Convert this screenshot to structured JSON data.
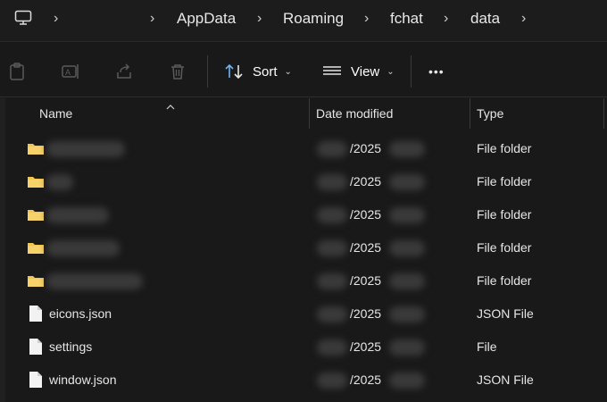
{
  "address_bar": {
    "icon": "monitor-icon",
    "segments": [
      "AppData",
      "Roaming",
      "fchat",
      "data"
    ]
  },
  "toolbar": {
    "sort_label": "Sort",
    "view_label": "View",
    "more_label": "•••"
  },
  "columns": {
    "name": "Name",
    "date_modified": "Date modified",
    "type": "Type"
  },
  "rows": [
    {
      "name": "",
      "date": "/2025",
      "type": "File folder",
      "icon": "folder-icon"
    },
    {
      "name": "",
      "date": "/2025",
      "type": "File folder",
      "icon": "folder-icon"
    },
    {
      "name": "",
      "date": "/2025",
      "type": "File folder",
      "icon": "folder-icon"
    },
    {
      "name": "",
      "date": "/2025",
      "type": "File folder",
      "icon": "folder-icon"
    },
    {
      "name": "",
      "date": "/2025",
      "type": "File folder",
      "icon": "folder-icon"
    },
    {
      "name": "eicons.json",
      "date": "/2025",
      "type": "JSON File",
      "icon": "file-icon"
    },
    {
      "name": "settings",
      "date": "/2025",
      "type": "File",
      "icon": "file-icon"
    },
    {
      "name": "window.json",
      "date": "/2025",
      "type": "JSON File",
      "icon": "file-icon"
    }
  ],
  "colors": {
    "folder": "#f4c54b",
    "background": "#191919"
  }
}
